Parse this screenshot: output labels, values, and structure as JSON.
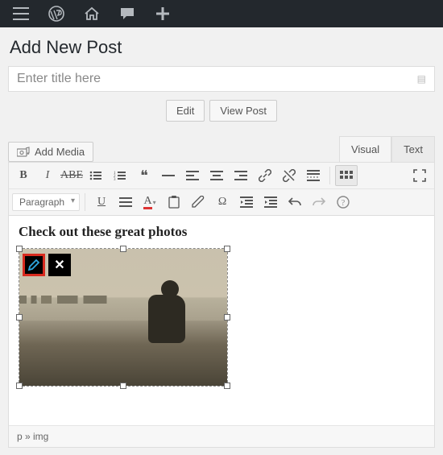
{
  "adminbar": {
    "items": [
      "menu-icon",
      "wordpress-icon",
      "home-icon",
      "comment-icon",
      "plus-icon"
    ]
  },
  "page": {
    "heading": "Add New Post",
    "title_placeholder": "Enter title here"
  },
  "permalink": {
    "edit_label": "Edit",
    "view_label": "View Post"
  },
  "media": {
    "add_label": "Add Media"
  },
  "editor_tabs": {
    "visual": "Visual",
    "text": "Text",
    "active": "visual"
  },
  "toolbar": {
    "row1": [
      "bold",
      "italic",
      "strike",
      "bullets",
      "numlist",
      "quote",
      "hr",
      "align-left",
      "align-center",
      "align-right",
      "link",
      "unlink",
      "more",
      "kitchen-sink",
      "fullscreen"
    ],
    "row2_select": "Paragraph",
    "row2": [
      "underline",
      "align-justify",
      "text-color",
      "paste",
      "clear",
      "omega",
      "outdent",
      "indent",
      "undo",
      "redo",
      "help"
    ]
  },
  "content": {
    "heading": "Check out these great photos"
  },
  "image_tools": {
    "edit": "edit-image",
    "remove": "remove-image"
  },
  "status_path": "p » img"
}
